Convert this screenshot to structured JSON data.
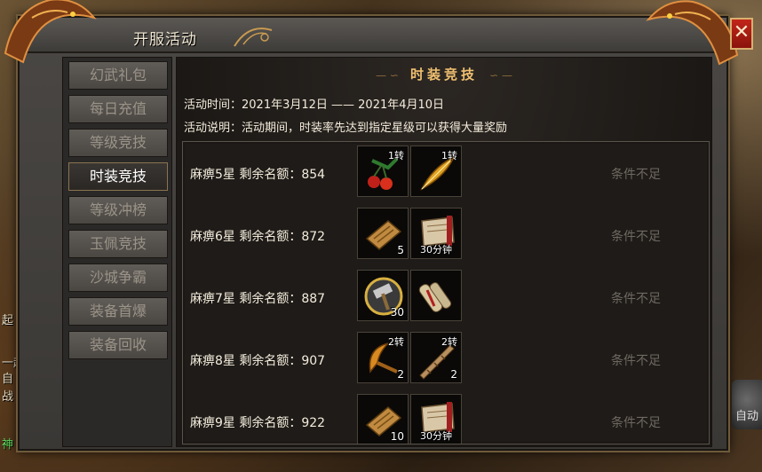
{
  "window": {
    "title": "开服活动",
    "close_label": "✕"
  },
  "sidebar": {
    "items": [
      {
        "label": "幻武礼包",
        "active": false
      },
      {
        "label": "每日充值",
        "active": false
      },
      {
        "label": "等级竞技",
        "active": false
      },
      {
        "label": "时装竞技",
        "active": true
      },
      {
        "label": "等级冲榜",
        "active": false
      },
      {
        "label": "玉佩竞技",
        "active": false
      },
      {
        "label": "沙城争霸",
        "active": false
      },
      {
        "label": "装备首爆",
        "active": false
      },
      {
        "label": "装备回收",
        "active": false
      }
    ]
  },
  "content": {
    "heading": "时装竞技",
    "time_line": "活动时间：2021年3月12日 —— 2021年4月10日",
    "desc_line": "活动说明：活动期间，时装率先达到指定星级可以获得大量奖励"
  },
  "rewards": [
    {
      "label": "麻痹5星  剩余名额：854",
      "status": "条件不足",
      "items": [
        {
          "icon": "cherry-fruit-icon",
          "badge": "1转",
          "count": "",
          "duration": ""
        },
        {
          "icon": "golden-feather-icon",
          "badge": "1转",
          "count": "",
          "duration": ""
        }
      ]
    },
    {
      "label": "麻痹6星  剩余名额：872",
      "status": "条件不足",
      "items": [
        {
          "icon": "scroll-book-icon",
          "badge": "",
          "count": "5",
          "duration": ""
        },
        {
          "icon": "open-scroll-icon",
          "badge": "",
          "count": "",
          "duration": "30分钟"
        }
      ]
    },
    {
      "label": "麻痹7星  剩余名额：887",
      "status": "条件不足",
      "items": [
        {
          "icon": "hammer-coin-icon",
          "badge": "",
          "count": "30",
          "duration": ""
        },
        {
          "icon": "rolled-scroll-icon",
          "badge": "",
          "count": "",
          "duration": ""
        }
      ]
    },
    {
      "label": "麻痹8星  剩余名额：907",
      "status": "条件不足",
      "items": [
        {
          "icon": "curved-blade-icon",
          "badge": "2转",
          "count": "2",
          "duration": ""
        },
        {
          "icon": "drill-spike-icon",
          "badge": "2转",
          "count": "2",
          "duration": ""
        }
      ]
    },
    {
      "label": "麻痹9星  剩余名额：922",
      "status": "条件不足",
      "items": [
        {
          "icon": "scroll-book-icon",
          "badge": "",
          "count": "10",
          "duration": ""
        },
        {
          "icon": "open-scroll-icon",
          "badge": "",
          "count": "",
          "duration": "30分钟"
        }
      ]
    }
  ],
  "world": {
    "line1": "起",
    "line2": "一起",
    "line3": "自",
    "line4": "战",
    "line5": "神",
    "auto_label": "自动"
  },
  "colors": {
    "active_tab_border": "#8a7450",
    "heading": "#f0c070",
    "status_disabled": "#6e6860",
    "close_button": "#c2261a"
  }
}
